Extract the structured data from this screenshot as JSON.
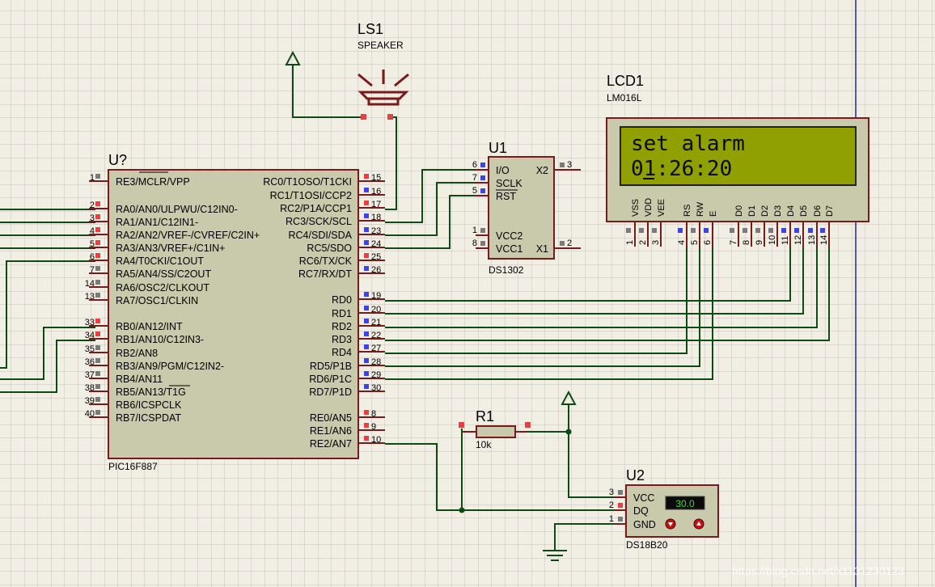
{
  "colors": {
    "background": "#f1efe4",
    "grid": "#c7bfbe",
    "wire": "#0f4a14",
    "component_fill": "#c9c9ac",
    "component_border": "#7a1a1a",
    "lcd_screen": "#8fa000",
    "pin_red": "#e84040",
    "pin_blue": "#3f43e0",
    "pin_gray": "#7a7a7a",
    "margin_line": "#2020c0"
  },
  "speaker": {
    "ref": "LS1",
    "value": "SPEAKER"
  },
  "mcu": {
    "ref": "U?",
    "part": "PIC16F887",
    "left_pins": [
      {
        "num": "1",
        "name": "RE3/MCLR/VPP"
      },
      {
        "num": "2",
        "name": "RA0/AN0/ULPWU/C12IN0-"
      },
      {
        "num": "3",
        "name": "RA1/AN1/C12IN1-"
      },
      {
        "num": "4",
        "name": "RA2/AN2/VREF-/CVREF/C2IN+"
      },
      {
        "num": "5",
        "name": "RA3/AN3/VREF+/C1IN+"
      },
      {
        "num": "6",
        "name": "RA4/T0CKI/C1OUT"
      },
      {
        "num": "7",
        "name": "RA5/AN4/SS/C2OUT"
      },
      {
        "num": "14",
        "name": "RA6/OSC2/CLKOUT"
      },
      {
        "num": "13",
        "name": "RA7/OSC1/CLKIN"
      },
      {
        "num": "33",
        "name": "RB0/AN12/INT"
      },
      {
        "num": "34",
        "name": "RB1/AN10/C12IN3-"
      },
      {
        "num": "35",
        "name": "RB2/AN8"
      },
      {
        "num": "36",
        "name": "RB3/AN9/PGM/C12IN2-"
      },
      {
        "num": "37",
        "name": "RB4/AN11"
      },
      {
        "num": "38",
        "name": "RB5/AN13/T1G"
      },
      {
        "num": "39",
        "name": "RB6/ICSPCLK"
      },
      {
        "num": "40",
        "name": "RB7/ICSPDAT"
      }
    ],
    "right_pins": [
      {
        "num": "15",
        "name": "RC0/T1OSO/T1CKI"
      },
      {
        "num": "16",
        "name": "RC1/T1OSI/CCP2"
      },
      {
        "num": "17",
        "name": "RC2/P1A/CCP1"
      },
      {
        "num": "18",
        "name": "RC3/SCK/SCL"
      },
      {
        "num": "23",
        "name": "RC4/SDI/SDA"
      },
      {
        "num": "24",
        "name": "RC5/SDO"
      },
      {
        "num": "25",
        "name": "RC6/TX/CK"
      },
      {
        "num": "26",
        "name": "RC7/RX/DT"
      },
      {
        "num": "19",
        "name": "RD0"
      },
      {
        "num": "20",
        "name": "RD1"
      },
      {
        "num": "21",
        "name": "RD2"
      },
      {
        "num": "22",
        "name": "RD3"
      },
      {
        "num": "27",
        "name": "RD4"
      },
      {
        "num": "28",
        "name": "RD5/P1B"
      },
      {
        "num": "29",
        "name": "RD6/P1C"
      },
      {
        "num": "30",
        "name": "RD7/P1D"
      },
      {
        "num": "8",
        "name": "RE0/AN5"
      },
      {
        "num": "9",
        "name": "RE1/AN6"
      },
      {
        "num": "10",
        "name": "RE2/AN7"
      }
    ]
  },
  "rtc": {
    "ref": "U1",
    "part": "DS1302",
    "left_pins": [
      {
        "num": "6",
        "name": "I/O"
      },
      {
        "num": "7",
        "name": "SCLK"
      },
      {
        "num": "5",
        "name": "RST"
      },
      {
        "num": "1",
        "name": "VCC2"
      },
      {
        "num": "8",
        "name": "VCC1"
      }
    ],
    "right_pins": [
      {
        "num": "3",
        "name": "X2"
      },
      {
        "num": "2",
        "name": "X1"
      }
    ]
  },
  "lcd": {
    "ref": "LCD1",
    "part": "LM016L",
    "line1": "set alarm",
    "line2": "01:26:20",
    "pins": [
      {
        "num": "1",
        "name": "VSS"
      },
      {
        "num": "2",
        "name": "VDD"
      },
      {
        "num": "3",
        "name": "VEE"
      },
      {
        "num": "4",
        "name": "RS"
      },
      {
        "num": "5",
        "name": "RW"
      },
      {
        "num": "6",
        "name": "E"
      },
      {
        "num": "7",
        "name": "D0"
      },
      {
        "num": "8",
        "name": "D1"
      },
      {
        "num": "9",
        "name": "D2"
      },
      {
        "num": "10",
        "name": "D3"
      },
      {
        "num": "11",
        "name": "D4"
      },
      {
        "num": "12",
        "name": "D5"
      },
      {
        "num": "13",
        "name": "D6"
      },
      {
        "num": "14",
        "name": "D7"
      }
    ]
  },
  "resistor": {
    "ref": "R1",
    "value": "10k"
  },
  "sensor": {
    "ref": "U2",
    "part": "DS18B20",
    "reading": "30.0",
    "pins": [
      {
        "num": "3",
        "name": "VCC"
      },
      {
        "num": "2",
        "name": "DQ"
      },
      {
        "num": "1",
        "name": "GND"
      }
    ]
  },
  "watermark": "https://blog.csdn.net/x1131230123"
}
